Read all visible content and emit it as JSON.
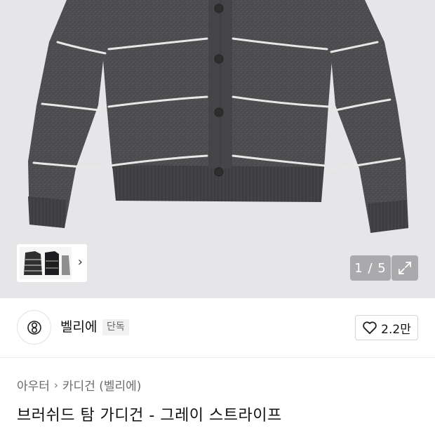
{
  "gallery": {
    "current_page": "1",
    "total_pages": "5",
    "page_separator": " / ",
    "thumbnail_next_icon": "chevron-right-icon",
    "expand_icon": "expand-arrows-icon"
  },
  "brand": {
    "logo_icon": "brand-emblem-icon",
    "name": "벨리에",
    "badge": "단독",
    "like_icon": "heart-outline-icon",
    "like_count": "2.2만"
  },
  "breadcrumb": {
    "items": [
      "아우터",
      "카디건 (벨리에)"
    ],
    "separator_icon": "chevron-right-icon"
  },
  "product": {
    "title": "브러쉬드 탐 가디건 - 그레이 스트라이프"
  },
  "colors": {
    "hero_background": "#e6e6e8",
    "sweater": "#4a4a4c",
    "stripe": "#e8e8e8"
  }
}
